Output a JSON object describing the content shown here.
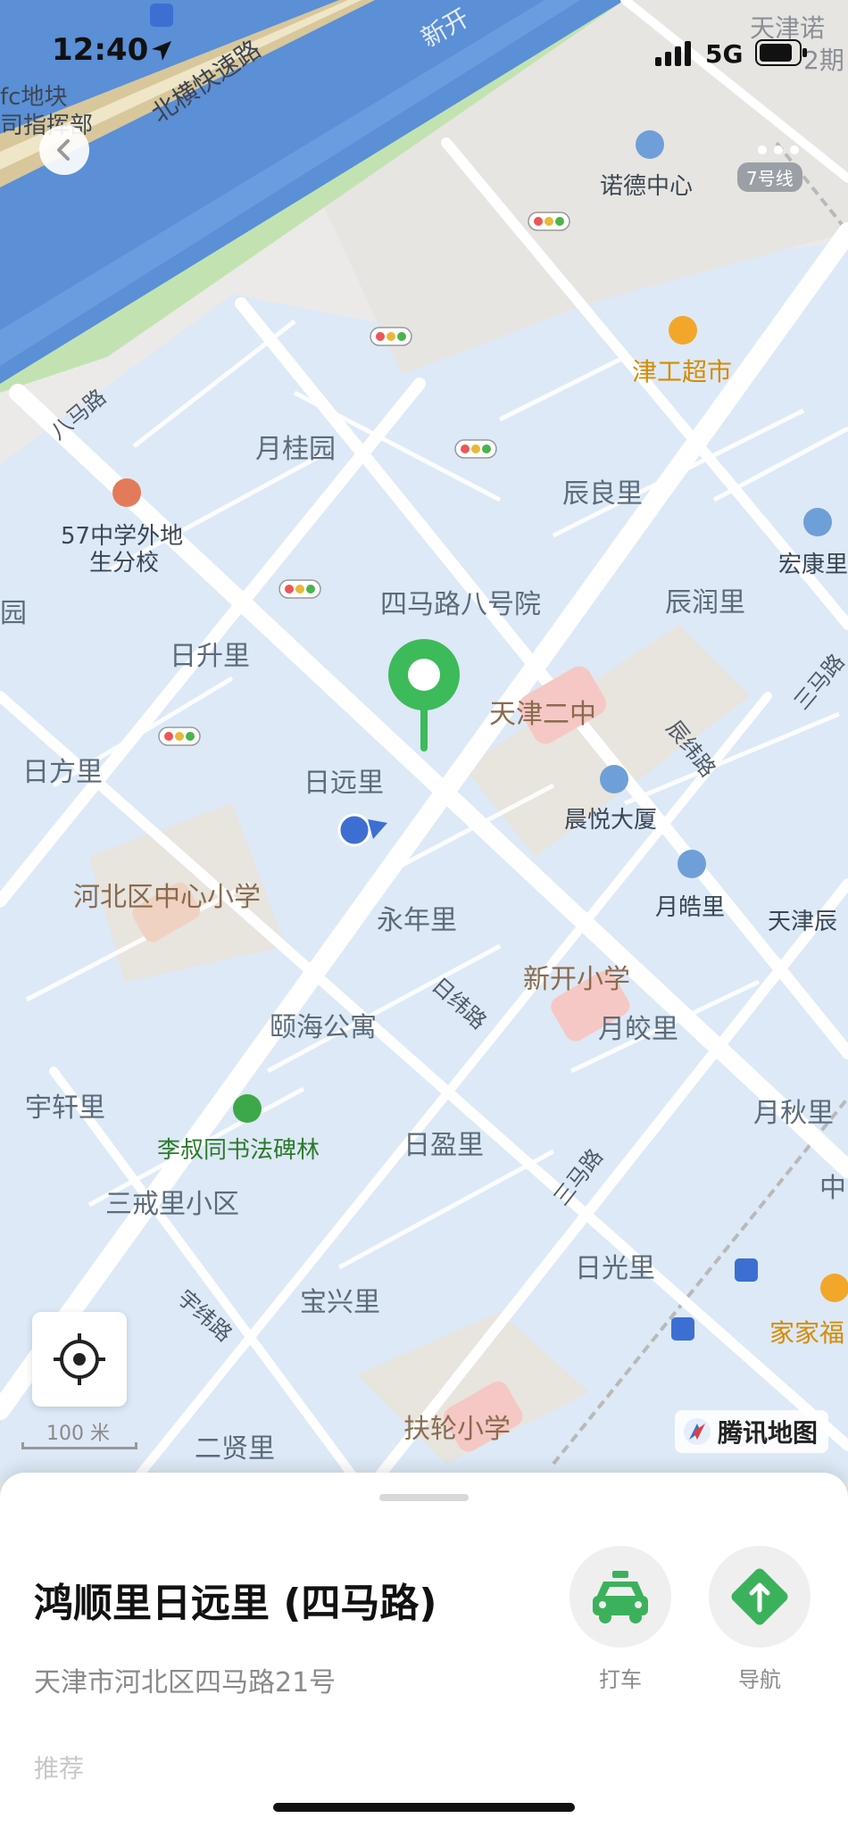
{
  "status_bar": {
    "time": "12:40",
    "network": "5G"
  },
  "map": {
    "brand": "腾讯地图",
    "scale_label": "100 米",
    "top_right_badge": "7号线",
    "road_labels": [
      "北横快速路",
      "八马路",
      "辰纬路",
      "日纬路",
      "宇纬路",
      "三马路",
      "新开"
    ],
    "pois": {
      "nuode": "诺德中心",
      "jingong": "津工超市",
      "yueguiyuan": "月桂园",
      "school57": "57中学外地",
      "school57b": "生分校",
      "chenliangli": "辰良里",
      "hongkang": "宏康里",
      "simalu8": "四马路八号院",
      "chenrun": "辰润里",
      "rishengli": "日升里",
      "tianjin2": "天津二中",
      "rifangli": "日方里",
      "riyuanli": "日远里",
      "chenyue": "晨悦大厦",
      "hebei_school": "河北区中心小学",
      "yongnian": "永年里",
      "yuehao": "月皓里",
      "tianjinchen": "天津辰",
      "xinkai_school": "新开小学",
      "yuejiao": "月皎里",
      "yihai": "颐海公寓",
      "yuxuan": "宇轩里",
      "lishutong": "李叔同书法碑林",
      "riyingli": "日盈里",
      "yueqiu": "月秋里",
      "sanjie": "三戒里小区",
      "riguang": "日光里",
      "baoxing": "宝兴里",
      "jiajiafu": "家家福",
      "fulun": "扶轮小学",
      "erxian": "二贤里",
      "tianjinnuo": "天津诺",
      "yuan": "园",
      "zhong": "中",
      "fc": "fc地块",
      "zhihuibu": "司指挥部",
      "erhao": "2期",
      "sanma": "三马路"
    }
  },
  "place": {
    "name": "鸿顺里日远里 (四马路)",
    "address": "天津市河北区四马路21号",
    "section_label": "推荐"
  },
  "actions": {
    "taxi": "打车",
    "navigate": "导航"
  },
  "colors": {
    "pin": "#3dba5a",
    "water": "#5b8fd6",
    "park": "#b9dfa5",
    "block": "#dde9f6",
    "action_green": "#3cb15c"
  }
}
